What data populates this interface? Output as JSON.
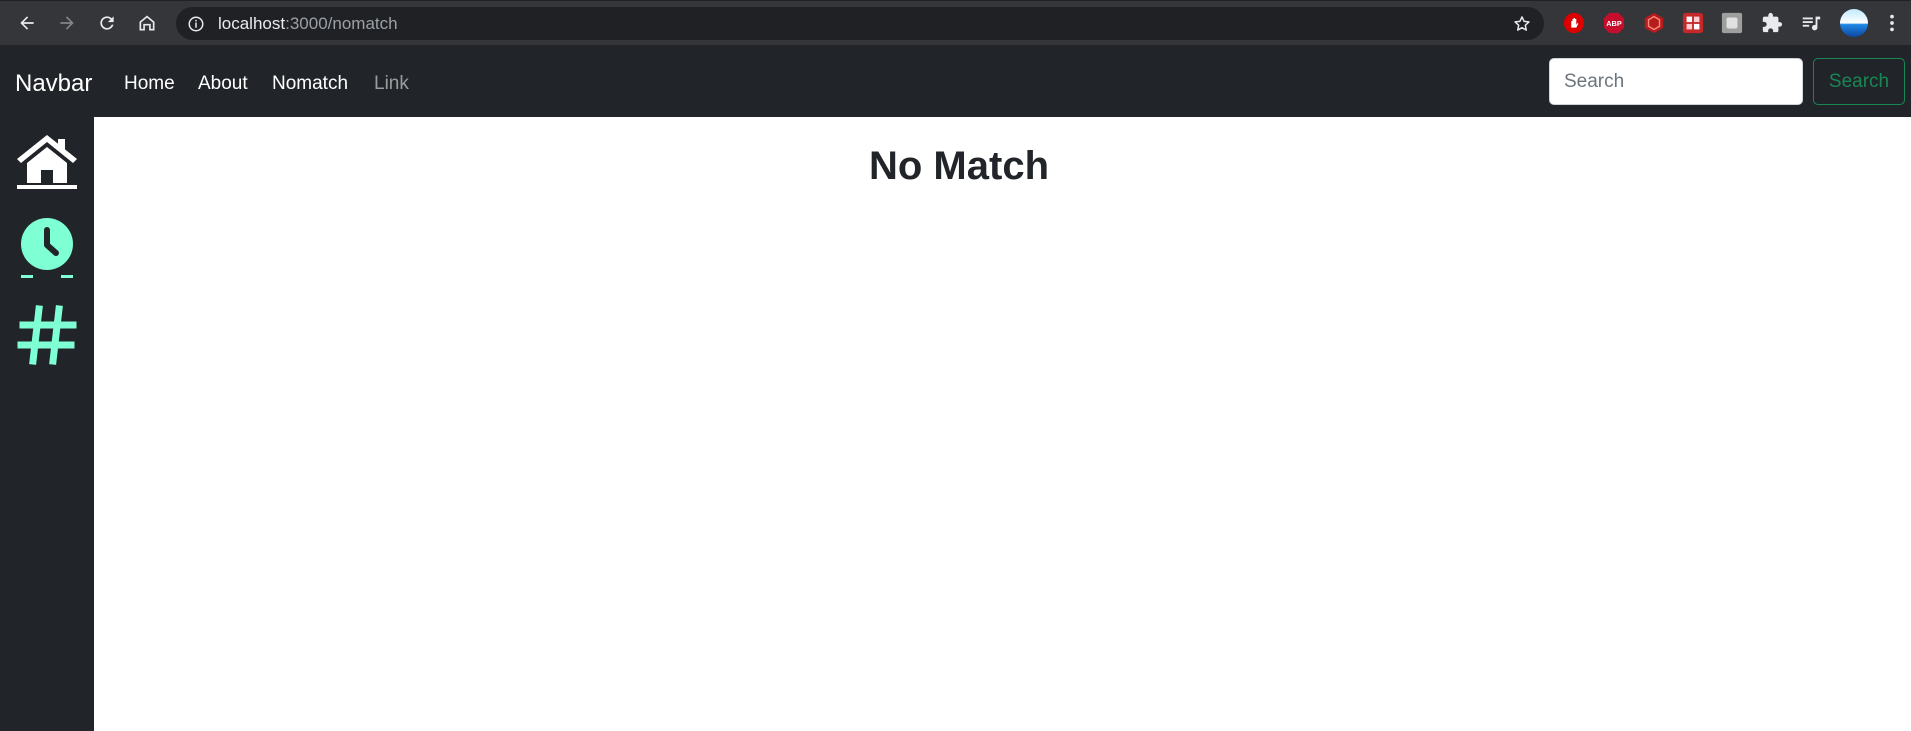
{
  "browser": {
    "url_host": "localhost",
    "url_path": ":3000/nomatch",
    "extensions": [
      "hand-stop-icon",
      "adblock-plus-icon",
      "red-hexagon-icon",
      "red-grid-icon",
      "gray-puzzle-tile-icon",
      "puzzle-extensions-icon",
      "media-queue-icon",
      "profile-avatar"
    ],
    "extension_labels": {
      "adblock": "ABP"
    }
  },
  "navbar": {
    "brand": "Navbar",
    "links": [
      {
        "label": "Home",
        "muted": false
      },
      {
        "label": "About",
        "muted": false
      },
      {
        "label": "Nomatch",
        "muted": false
      },
      {
        "label": "Link",
        "muted": true
      }
    ],
    "search": {
      "placeholder": "Search",
      "button_label": "Search"
    }
  },
  "sidebar": {
    "items": [
      "home-icon",
      "clock-icon",
      "hashtag-icon"
    ],
    "colors": {
      "home": "#ffffff",
      "clock": "#7fffd4",
      "hashtag": "#7fffd4"
    }
  },
  "main": {
    "title": "No Match"
  },
  "colors": {
    "navbar_bg": "#212529",
    "chrome_bg": "#35363a",
    "success": "#198754",
    "accent": "#7fffd4"
  }
}
